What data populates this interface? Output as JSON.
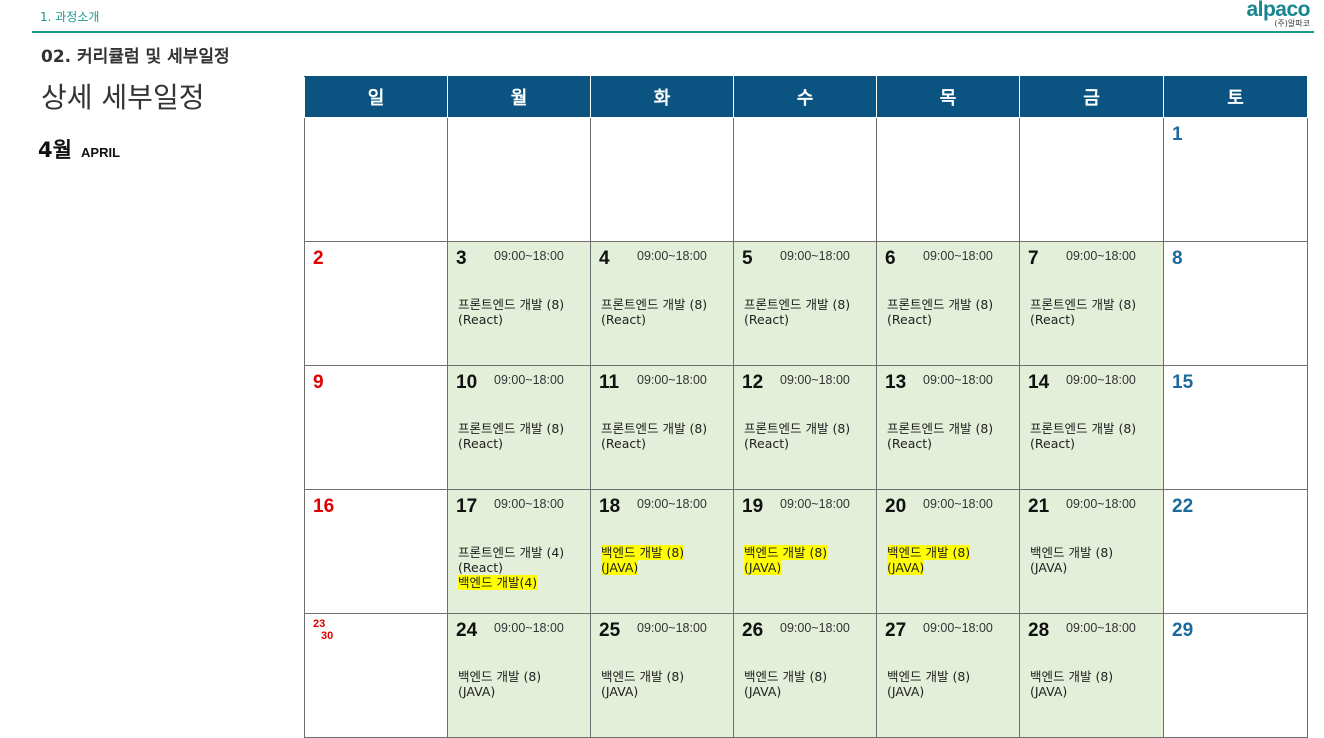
{
  "header": {
    "section": "1. 과정소개",
    "logo": "alpaco",
    "logo_sub": "(주)알파코"
  },
  "subtitle": "02. 커리큘럼 및 세부일정",
  "heading": "상세 세부일정",
  "month": {
    "num": "4월",
    "en": "APRIL"
  },
  "colors": {
    "header_bg": "#0b5380",
    "class_day_bg": "#e3efd9",
    "sunday": "#e00000",
    "saturday": "#1a6a9e",
    "highlight": "#ffff00",
    "accent": "#1a9a8e"
  },
  "weekdays": [
    "일",
    "월",
    "화",
    "수",
    "목",
    "금",
    "토"
  ],
  "weeks": [
    [
      {
        "day": ""
      },
      {
        "day": ""
      },
      {
        "day": ""
      },
      {
        "day": ""
      },
      {
        "day": ""
      },
      {
        "day": ""
      },
      {
        "day": "1"
      }
    ],
    [
      {
        "day": "2"
      },
      {
        "day": "3",
        "time": "09:00~18:00",
        "course1": "프론트엔드 개발 (8)",
        "course2": "(React)"
      },
      {
        "day": "4",
        "time": "09:00~18:00",
        "course1": "프론트엔드 개발 (8)",
        "course2": "(React)"
      },
      {
        "day": "5",
        "time": "09:00~18:00",
        "course1": "프론트엔드 개발 (8)",
        "course2": "(React)"
      },
      {
        "day": "6",
        "time": "09:00~18:00",
        "course1": "프론트엔드 개발 (8)",
        "course2": "(React)"
      },
      {
        "day": "7",
        "time": "09:00~18:00",
        "course1": "프론트엔드 개발 (8)",
        "course2": "(React)"
      },
      {
        "day": "8"
      }
    ],
    [
      {
        "day": "9"
      },
      {
        "day": "10",
        "time": "09:00~18:00",
        "course1": "프론트엔드 개발 (8)",
        "course2": "(React)"
      },
      {
        "day": "11",
        "time": "09:00~18:00",
        "course1": "프론트엔드 개발 (8)",
        "course2": "(React)"
      },
      {
        "day": "12",
        "time": "09:00~18:00",
        "course1": "프론트엔드 개발 (8)",
        "course2": "(React)"
      },
      {
        "day": "13",
        "time": "09:00~18:00",
        "course1": "프론트엔드 개발 (8)",
        "course2": "(React)"
      },
      {
        "day": "14",
        "time": "09:00~18:00",
        "course1": "프론트엔드 개발 (8)",
        "course2": "(React)"
      },
      {
        "day": "15"
      }
    ],
    [
      {
        "day": "16"
      },
      {
        "day": "17",
        "time": "09:00~18:00",
        "course1": "프론트엔드 개발 (4)",
        "course2": "(React)",
        "course3": "백엔드 개발(4)"
      },
      {
        "day": "18",
        "time": "09:00~18:00",
        "course1": "백엔드 개발 (8)",
        "course2": "(JAVA)"
      },
      {
        "day": "19",
        "time": "09:00~18:00",
        "course1": "백엔드 개발 (8)",
        "course2": "(JAVA)"
      },
      {
        "day": "20",
        "time": "09:00~18:00",
        "course1": "백엔드 개발 (8)",
        "course2": "(JAVA)"
      },
      {
        "day": "21",
        "time": "09:00~18:00",
        "course1": "백엔드 개발 (8)",
        "course2": "(JAVA)"
      },
      {
        "day": "22"
      }
    ],
    [
      {
        "day": "23",
        "day_b": "30"
      },
      {
        "day": "24",
        "time": "09:00~18:00",
        "course1": "백엔드 개발 (8)",
        "course2": "(JAVA)"
      },
      {
        "day": "25",
        "time": "09:00~18:00",
        "course1": "백엔드 개발 (8)",
        "course2": "(JAVA)"
      },
      {
        "day": "26",
        "time": "09:00~18:00",
        "course1": "백엔드 개발 (8)",
        "course2": "(JAVA)"
      },
      {
        "day": "27",
        "time": "09:00~18:00",
        "course1": "백엔드 개발 (8)",
        "course2": "(JAVA)"
      },
      {
        "day": "28",
        "time": "09:00~18:00",
        "course1": "백엔드 개발 (8)",
        "course2": "(JAVA)"
      },
      {
        "day": "29"
      }
    ]
  ]
}
